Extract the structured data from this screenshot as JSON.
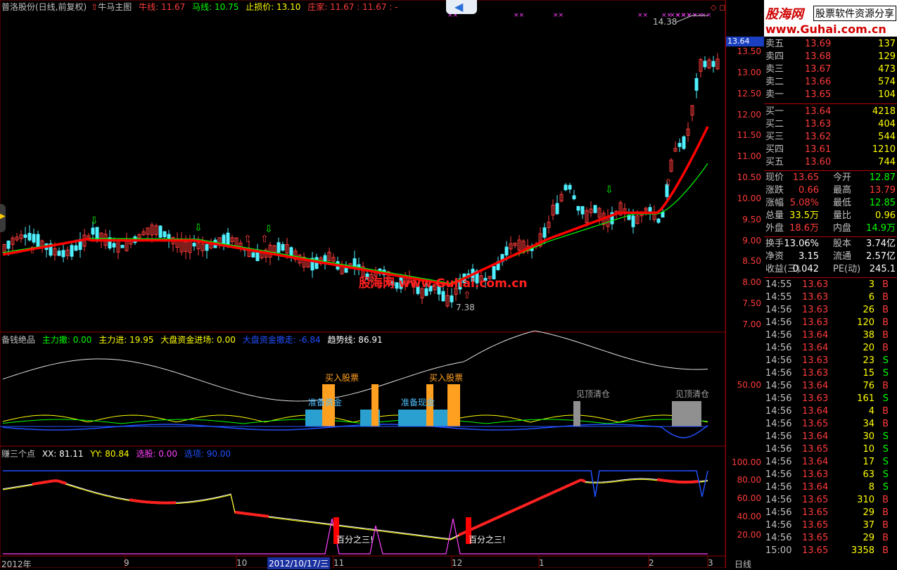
{
  "header": {
    "title": "普洛股份(日线,前复权)",
    "indicator": "牛马主图",
    "niu": "牛线: 11.67",
    "ma": "马线: 10.75",
    "stop": "止损价: 13.10",
    "dealer": "庄家: 11.67",
    "dealer2": ": 11.67",
    "dash": ": -"
  },
  "watermark": {
    "site": "股海网",
    "slogan": "股票软件资源分享",
    "url": "www.Guhai.com.cn"
  },
  "main_chart": {
    "high_label": "14.38",
    "low_label": "7.38",
    "watermark": "股海网 www.Guhai.com.cn",
    "price_marker": "13.64",
    "price_axis": [
      "13.50",
      "13.00",
      "12.50",
      "12.00",
      "11.50",
      "11.00",
      "10.50",
      "10.00",
      "9.50",
      "9.00",
      "8.50",
      "8.00",
      "7.50",
      "7.00"
    ],
    "up_color": "#ff3b3b",
    "down_color": "#4ff0ff",
    "niu_color": "#ff0000",
    "ma_color": "#00ff00"
  },
  "sub1": {
    "name": "备钱绝品",
    "a": "主力撤: 0.00",
    "b": "主力进: 19.95",
    "c": "大盘资金进场: 0.00",
    "d": "大盘资金撤走: -6.84",
    "e": "趋势线: 86.91",
    "axis": "50.00",
    "buy1": "买入股票",
    "buy2": "买入股票",
    "prep1": "准备资金",
    "prep2": "准备现金",
    "top1": "见顶清仓",
    "top2": "见顶清仓"
  },
  "sub2": {
    "name": "赚三个点",
    "xx": "XX: 81.11",
    "yy": "YY: 80.84",
    "pick": "选股: 0.00",
    "sel": "选项: 90.00",
    "axis": [
      "100.00",
      "80.00",
      "60.00",
      "40.00",
      "20.00"
    ],
    "note1": "百分之三!",
    "note2": "百分之三!"
  },
  "time_axis": {
    "labels": [
      "2012年",
      "9",
      "10",
      "2012/10/17/三",
      "11",
      "12",
      "1",
      "2",
      "3"
    ],
    "period": "日线"
  },
  "quote": {
    "asks": [
      {
        "label": "卖五",
        "price": "13.69",
        "vol": "137"
      },
      {
        "label": "卖四",
        "price": "13.68",
        "vol": "129"
      },
      {
        "label": "卖三",
        "price": "13.67",
        "vol": "473"
      },
      {
        "label": "卖二",
        "price": "13.66",
        "vol": "574"
      },
      {
        "label": "卖一",
        "price": "13.65",
        "vol": "104"
      }
    ],
    "bids": [
      {
        "label": "买一",
        "price": "13.64",
        "vol": "4218"
      },
      {
        "label": "买二",
        "price": "13.63",
        "vol": "404"
      },
      {
        "label": "买三",
        "price": "13.62",
        "vol": "544"
      },
      {
        "label": "买四",
        "price": "13.61",
        "vol": "1210"
      },
      {
        "label": "买五",
        "price": "13.60",
        "vol": "744"
      }
    ],
    "stats": [
      {
        "l1": "现价",
        "v1": "13.65",
        "l2": "今开",
        "v2": "12.87"
      },
      {
        "l1": "涨跌",
        "v1": "0.66",
        "l2": "最高",
        "v2": "13.79"
      },
      {
        "l1": "涨幅",
        "v1": "5.08%",
        "l2": "最低",
        "v2": "12.85"
      },
      {
        "l1": "总量",
        "v1": "33.5万",
        "l2": "量比",
        "v2": "0.96"
      },
      {
        "l1": "外盘",
        "v1": "18.6万",
        "l2": "内盘",
        "v2": "14.9万"
      }
    ],
    "stats2": [
      {
        "l1": "换手",
        "v1": "13.06%",
        "l2": "股本",
        "v2": "3.74亿"
      },
      {
        "l1": "净资",
        "v1": "3.15",
        "l2": "流通",
        "v2": "2.57亿"
      },
      {
        "l1": "收益(三)",
        "v1": "0.042",
        "l2": "PE(动)",
        "v2": "245.1"
      }
    ],
    "trades": [
      {
        "t": "14:55",
        "p": "13.63",
        "v": "3",
        "s": "B"
      },
      {
        "t": "14:55",
        "p": "13.63",
        "v": "6",
        "s": "B"
      },
      {
        "t": "14:56",
        "p": "13.63",
        "v": "26",
        "s": "B"
      },
      {
        "t": "14:56",
        "p": "13.63",
        "v": "120",
        "s": "B"
      },
      {
        "t": "14:56",
        "p": "13.64",
        "v": "38",
        "s": "B"
      },
      {
        "t": "14:56",
        "p": "13.64",
        "v": "20",
        "s": "B"
      },
      {
        "t": "14:56",
        "p": "13.63",
        "v": "23",
        "s": "S"
      },
      {
        "t": "14:56",
        "p": "13.63",
        "v": "15",
        "s": "S"
      },
      {
        "t": "14:56",
        "p": "13.64",
        "v": "76",
        "s": "B"
      },
      {
        "t": "14:56",
        "p": "13.63",
        "v": "161",
        "s": "S"
      },
      {
        "t": "14:56",
        "p": "13.64",
        "v": "4",
        "s": "B"
      },
      {
        "t": "14:56",
        "p": "13.65",
        "v": "34",
        "s": "B"
      },
      {
        "t": "14:56",
        "p": "13.64",
        "v": "30",
        "s": "S"
      },
      {
        "t": "14:56",
        "p": "13.65",
        "v": "10",
        "s": "S"
      },
      {
        "t": "14:56",
        "p": "13.64",
        "v": "17",
        "s": "S"
      },
      {
        "t": "14:56",
        "p": "13.63",
        "v": "63",
        "s": "S"
      },
      {
        "t": "14:56",
        "p": "13.64",
        "v": "8",
        "s": "S"
      },
      {
        "t": "14:56",
        "p": "13.65",
        "v": "310",
        "s": "B"
      },
      {
        "t": "14:56",
        "p": "13.65",
        "v": "29",
        "s": "B"
      },
      {
        "t": "14:56",
        "p": "13.65",
        "v": "37",
        "s": "B"
      },
      {
        "t": "14:56",
        "p": "13.65",
        "v": "29",
        "s": "B"
      },
      {
        "t": "15:00",
        "p": "13.65",
        "v": "3358",
        "s": "B"
      }
    ]
  }
}
